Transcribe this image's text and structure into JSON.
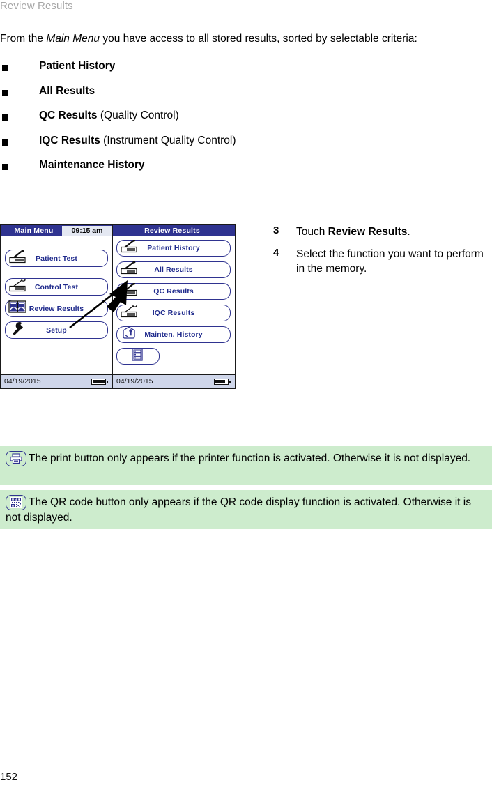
{
  "header": {
    "running_title": "Review Results"
  },
  "intro": {
    "before": "From the ",
    "italic": "Main Menu",
    "after": " you have access to all stored results, sorted by selectable criteria:"
  },
  "bullets": [
    {
      "bold": "Patient History",
      "normal": ""
    },
    {
      "bold": "All Results",
      "normal": ""
    },
    {
      "bold": "QC Results",
      "normal": " (Quality Control)"
    },
    {
      "bold": "IQC Results",
      "normal": " (Instrument Quality Control)"
    },
    {
      "bold": "Maintenance History",
      "normal": ""
    }
  ],
  "device": {
    "main_menu": {
      "title": "Main Menu",
      "time": "09:15 am",
      "date": "04/19/2015",
      "buttons": [
        {
          "label": "Patient Test",
          "icon": "lancet-strip-icon"
        },
        {
          "label": "Control Test",
          "icon": "pipette-strip-icon"
        },
        {
          "label": "Review Results",
          "icon": "open-book-icon"
        },
        {
          "label": "Setup",
          "icon": "wrench-icon"
        }
      ]
    },
    "review_results": {
      "title": "Review Results",
      "date": "04/19/2015",
      "buttons": [
        {
          "label": "Patient History",
          "icon": "lancet-strip-icon"
        },
        {
          "label": "All Results",
          "icon": "lancet-strip-icon"
        },
        {
          "label": "QC Results",
          "icon": "lancet-strip-icon"
        },
        {
          "label": "IQC Results",
          "icon": "pipette-strip-icon"
        },
        {
          "label": "Mainten. History",
          "icon": "maintenance-bottle-icon"
        },
        {
          "label": "",
          "icon": "database-list-icon"
        }
      ]
    }
  },
  "steps": [
    {
      "num": "3",
      "before": "Touch ",
      "bold": "Review Results",
      "after": "."
    },
    {
      "num": "4",
      "before": "Select the function you want to perform in the memory.",
      "bold": "",
      "after": ""
    }
  ],
  "notes": [
    {
      "icon": "printer-icon",
      "text": "The print button only appears if the printer function is activated. Otherwise it is not displayed."
    },
    {
      "icon": "qr-code-icon",
      "text": "The QR code button only appears if the QR code display function is activated. Otherwise it is not displayed."
    }
  ],
  "footer": {
    "page_number": "152"
  },
  "colors": {
    "device_blue": "#2f3390",
    "label_blue": "#1f2a8c",
    "status_bar": "#cfd6ea",
    "note_green": "#cdeccd",
    "running_head_gray": "#a6a6a6"
  }
}
